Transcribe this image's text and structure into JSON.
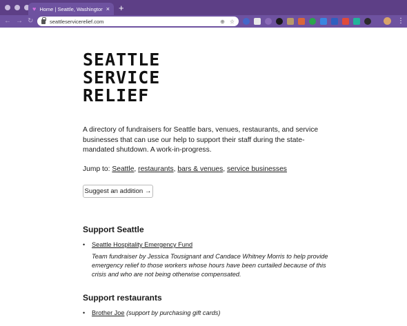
{
  "browser": {
    "tab_title": "Home | Seattle, Washington Service Relief",
    "url": "seattleservicerelief.com",
    "new_tab_label": "+",
    "close_label": "×"
  },
  "logo": {
    "line1": "SEATTLE",
    "line2": "SERVICE",
    "line3": "RELIEF"
  },
  "intro": "A directory of fundraisers for Seattle bars, venues, restaurants, and service businesses that can use our help to support their staff during the state-mandated shutdown. A work-in-progress.",
  "jump": {
    "prefix": "Jump to: ",
    "links": [
      "Seattle",
      "restaurants",
      "bars & venues",
      "service businesses"
    ]
  },
  "suggest_button": "Suggest an addition →",
  "sections": [
    {
      "heading": "Support Seattle",
      "items": [
        {
          "link": "Seattle Hospitality Emergency Fund",
          "description": "Team fundraiser by Jessica Tousignant and Candace Whitney Morris to help provide emergency relief to those workers whose hours have been curtailed because of this crisis and who are not being otherwise compensated."
        }
      ]
    },
    {
      "heading": "Support restaurants",
      "items": [
        {
          "link": "Brother Joe",
          "note": "(support by purchasing gift cards)"
        }
      ]
    }
  ]
}
